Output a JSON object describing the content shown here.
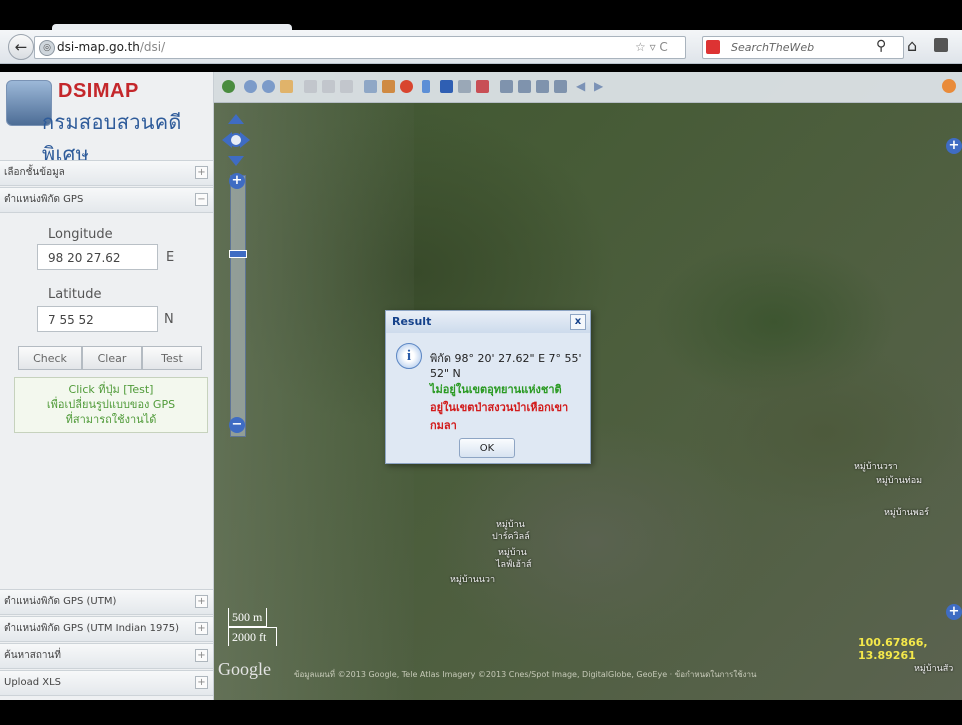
{
  "browser": {
    "url_host": "dsi-map.go.th",
    "url_path": "/dsi/",
    "url_controls": "☆ ▿ C",
    "search_placeholder": "SearchTheWeb"
  },
  "logo": {
    "title": "DSIMAP",
    "subtitle": "กรมสอบสวนคดีพิเศษ"
  },
  "sidebar": {
    "panels": [
      {
        "label": "เลือกชั้นข้อมูล",
        "toggle": "+"
      },
      {
        "label": "ตำแหน่งพิกัด GPS",
        "toggle": "−"
      },
      {
        "label": "ตำแหน่งพิกัด GPS (UTM)",
        "toggle": "+"
      },
      {
        "label": "ตำแหน่งพิกัด GPS (UTM Indian 1975)",
        "toggle": "+"
      },
      {
        "label": "ค้นหาสถานที่",
        "toggle": "+"
      },
      {
        "label": "Upload XLS",
        "toggle": "+"
      }
    ],
    "gps": {
      "longitude_label": "Longitude",
      "longitude_value": "98 20 27.62",
      "longitude_unit": "E",
      "latitude_label": "Latitude",
      "latitude_value": "7 55 52",
      "latitude_unit": "N",
      "check_label": "Check",
      "clear_label": "Clear",
      "test_label": "Test",
      "info_lines": [
        "Click ที่ปุ่ม [Test]",
        "เพื่อเปลี่ยนรูปแบบของ GPS",
        "ที่สามารถใช้งานได้"
      ]
    }
  },
  "map": {
    "scale_m": "500 m",
    "scale_ft": "2000 ft",
    "google": "Google",
    "copyright": "ข้อมูลแผนที่ ©2013 Google, Tele Atlas Imagery ©2013 Cnes/Spot Image, DigitalGlobe, GeoEye · ข้อกำหนดในการใช้งาน",
    "coords": "100.67866, 13.89261",
    "places": [
      "หมู่บ้านวรา",
      "หมู่บ้านท่อม",
      "หมู่บ้าน",
      "ปาร์ควิลล์",
      "หมู่บ้าน",
      "ไลฟ์เฮ้าส์",
      "หมู่บ้านนวา",
      "หมู่บ้านพอร์",
      "หมู่บ้านสัว"
    ]
  },
  "dialog": {
    "title": "Result",
    "close": "x",
    "info": "i",
    "coord_text": "พิกัด 98° 20' 27.62\" E 7° 55' 52\" N",
    "line1": "ไม่อยู่ในเขตอุทยานแห่งชาติ",
    "line2": "อยู่ในเขตป่าสงวนป่าเหือกเขากมลา",
    "ok": "OK"
  },
  "colors": {
    "logo_red": "#c4272b",
    "logo_blue": "#2e5b9a",
    "info_green": "#4f9a38",
    "dialog_green": "#2a9a22",
    "dialog_red": "#d21b1b",
    "map_control": "#3f6cc3"
  }
}
